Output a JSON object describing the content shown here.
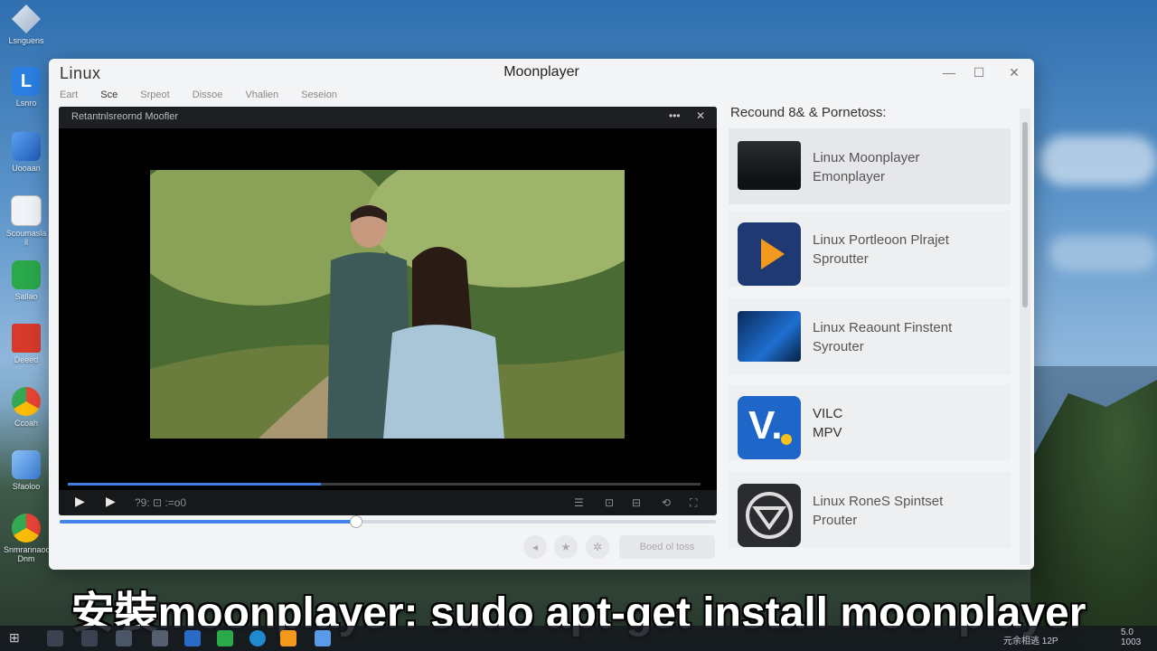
{
  "desktop": {
    "icons": [
      {
        "label": "Lsnguens",
        "icon": "os-logo-icon",
        "color": "#c9d6e6"
      },
      {
        "label": "Lsnro",
        "icon": "app-l-icon",
        "color": "#2b7fe0"
      },
      {
        "label": "Uooaan",
        "icon": "app-blue-icon",
        "color": "#2a6bc8"
      },
      {
        "label": "Scoumasla\nil",
        "icon": "store-icon",
        "color": "#f0f4f8"
      },
      {
        "label": "Sallao",
        "icon": "nvidia-icon",
        "color": "#2aa84a"
      },
      {
        "label": "Deeed",
        "icon": "folder-red-icon",
        "color": "#d83a2a"
      },
      {
        "label": "Ccoah",
        "icon": "chrome-icon",
        "color": "#e94335"
      },
      {
        "label": "Sfaoloo",
        "icon": "cube-icon",
        "color": "#5a9ae6"
      },
      {
        "label": "Snmrannaoo\nDnm",
        "icon": "chrome-icon",
        "color": "#fbbc05"
      }
    ]
  },
  "window": {
    "app_label": "Linux",
    "title": "Moonplayer",
    "menu": [
      "Eart",
      "Sce",
      "Srpeot",
      "Dissoe",
      "Vhalien",
      "Seseion"
    ]
  },
  "player": {
    "title": "Retantnlsreornd Moofler",
    "time_text": "?9: ⊡ :=o0",
    "progress": 0.45,
    "buffer": 0.4,
    "seek_button_label": "Boed ol toss"
  },
  "right_panel": {
    "heading": "Recound 8& & Pornetoss:",
    "items": [
      {
        "line1": "Linux Moonplayer",
        "line2": "Emonplayer",
        "icon": "monitor-icon"
      },
      {
        "line1": "Linux Portleoon Plrajet",
        "line2": "Sproutter",
        "icon": "play-icon"
      },
      {
        "line1": "Linux Reaount Finstent",
        "line2": "Syrouter",
        "icon": "desktop-icon"
      },
      {
        "line1": "VILC",
        "line2": "MPV",
        "icon": "vilc-icon"
      },
      {
        "line1": "Linux RoneS Spintset",
        "line2": "Prouter",
        "icon": "vector-icon"
      }
    ]
  },
  "subtitle": "安裝moonplayer: sudo apt-get install moonplayer",
  "taskbar": {
    "tray_text": "元余相逃 12P",
    "time": "5.0\n1003"
  }
}
